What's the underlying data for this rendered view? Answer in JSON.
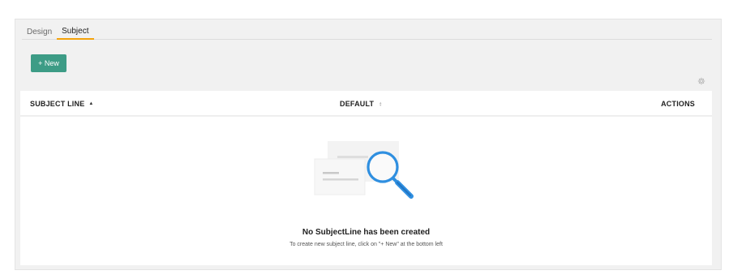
{
  "tabs": [
    {
      "label": "Design",
      "active": false
    },
    {
      "label": "Subject",
      "active": true
    }
  ],
  "toolbar": {
    "new_label": "+ New"
  },
  "table": {
    "columns": {
      "subject_line": "SUBJECT LINE",
      "default": "DEFAULT",
      "actions": "ACTIONS"
    },
    "sort": {
      "column": "subject_line",
      "direction": "ascending"
    }
  },
  "empty_state": {
    "title": "No SubjectLine has been created",
    "subtitle": "To create new subject line, click on \"+ New\" at the bottom left"
  },
  "icons": [
    "settings-gear-icon",
    "sort-ascending-icon",
    "sort-both-icon",
    "magnifier-illustration"
  ],
  "colors": {
    "accent": "#3d9c86",
    "tab_underline": "#f3a20a",
    "illustration_blue": "#2f8fe0"
  }
}
